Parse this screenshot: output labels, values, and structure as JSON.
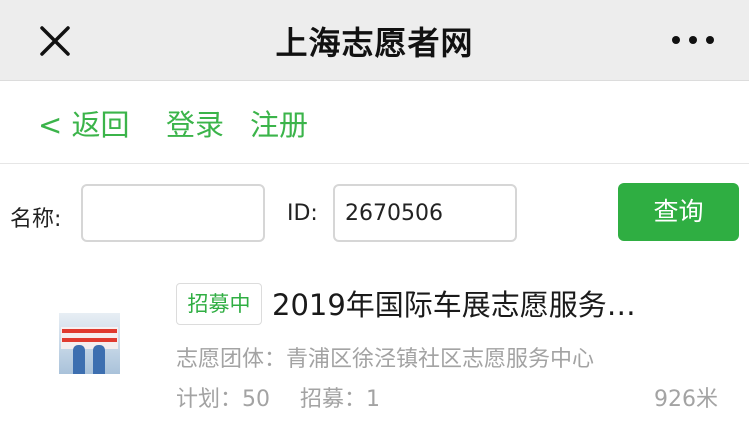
{
  "topbar": {
    "title": "上海志愿者网",
    "close_icon": "close-icon",
    "more_icon": "more-dots-icon"
  },
  "nav": {
    "back": "< 返回",
    "login": "登录",
    "register": "注册"
  },
  "search": {
    "name_label": "名称:",
    "name_value": "",
    "id_label": "ID:",
    "id_value": "2670506",
    "query_button": "查询"
  },
  "results": [
    {
      "badge": "招募中",
      "title": "2019年国际车展志愿服务…",
      "org": "志愿团体：青浦区徐泾镇社区志愿服务中心",
      "plan": "计划：50",
      "recruit": "招募：1",
      "distance": "926米"
    }
  ],
  "colors": {
    "accent_green": "#2fae42",
    "link_green": "#3bb44a",
    "muted_text": "#a3a3a3",
    "topbar_bg": "#ededed"
  }
}
